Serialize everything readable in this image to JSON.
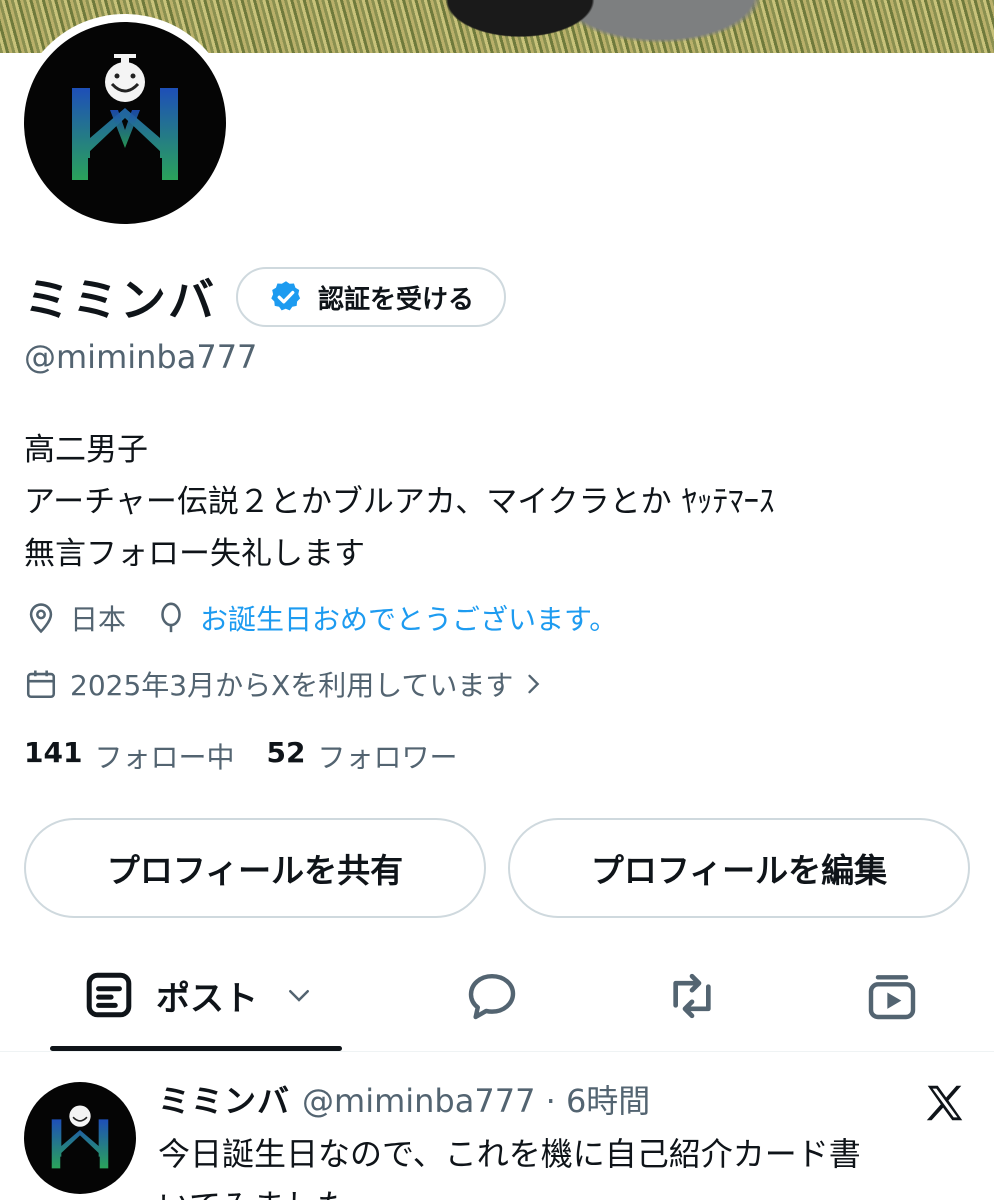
{
  "profile": {
    "display_name": "ミミンバ",
    "verify_label": "認証を受ける",
    "handle": "@miminba777",
    "bio_lines": [
      "高二男子",
      "アーチャー伝説２とかブルアカ、マイクラとか ﾔｯﾃﾏｰｽ",
      "無言フォロー失礼します"
    ],
    "location": "日本",
    "birthday": "お誕生日おめでとうございます。",
    "joined": "2025年3月からXを利用しています",
    "following_count": "141",
    "following_label": "フォロー中",
    "followers_count": "52",
    "followers_label": "フォロワー"
  },
  "buttons": {
    "share": "プロフィールを共有",
    "edit": "プロフィールを編集"
  },
  "tabs": {
    "posts_label": "ポスト"
  },
  "tweet": {
    "name": "ミミンバ",
    "meta": "@miminba777 · 6時間",
    "text_lines": [
      "今日誕生日なので、これを機に自己紹介カード書",
      "いてみました"
    ]
  },
  "colors": {
    "link": "#1d9bf0",
    "muted": "#536471",
    "text": "#0f1419",
    "border": "#cfd9de"
  },
  "icons": [
    "location-pin-icon",
    "balloon-icon",
    "calendar-icon",
    "chevron-right-icon",
    "verified-badge-icon",
    "posts-tab-icon",
    "chevron-down-icon",
    "replies-icon",
    "reposts-icon",
    "media-icon",
    "x-logo-icon"
  ]
}
